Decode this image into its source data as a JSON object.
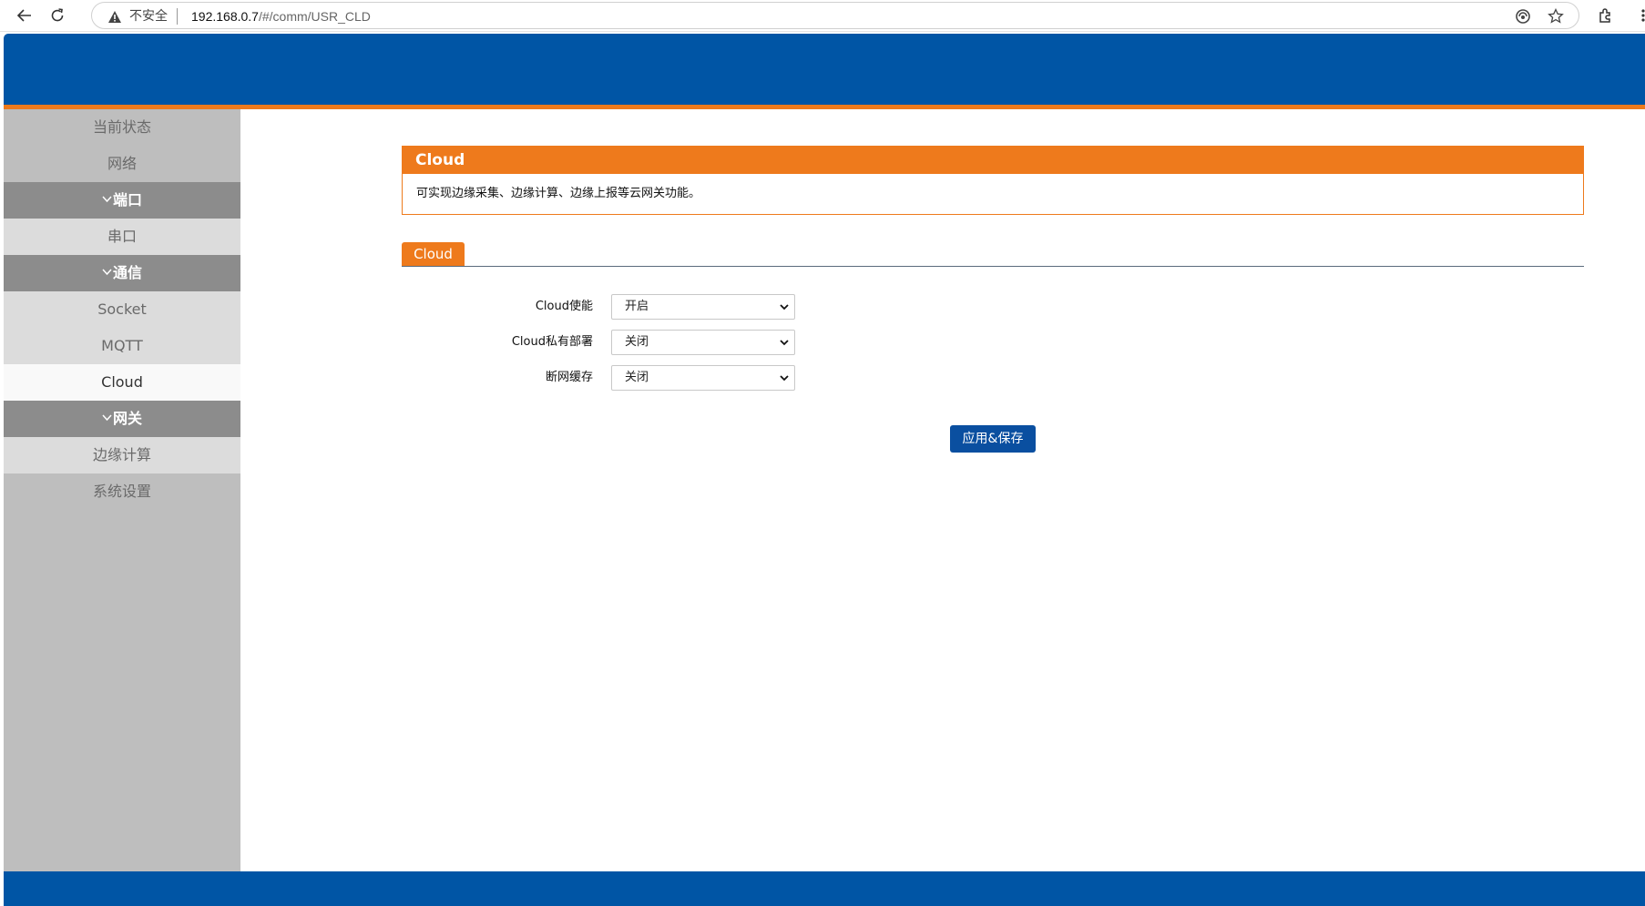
{
  "browser": {
    "insecure_label": "不安全",
    "url_host": "192.168.0.7",
    "url_path": "/#/comm/USR_CLD"
  },
  "sidebar": {
    "items": [
      {
        "label": "当前状态"
      },
      {
        "label": "网络"
      },
      {
        "label": "端口"
      },
      {
        "label": "串口"
      },
      {
        "label": "通信"
      },
      {
        "label": "Socket"
      },
      {
        "label": "MQTT"
      },
      {
        "label": "Cloud"
      },
      {
        "label": "网关"
      },
      {
        "label": "边缘计算"
      },
      {
        "label": "系统设置"
      }
    ]
  },
  "panel": {
    "title": "Cloud",
    "description": "可实现边缘采集、边缘计算、边缘上报等云网关功能。"
  },
  "tab": {
    "label": "Cloud"
  },
  "form": {
    "rows": [
      {
        "label": "Cloud使能",
        "value": "开启"
      },
      {
        "label": "Cloud私有部署",
        "value": "关闭"
      },
      {
        "label": "断网缓存",
        "value": "关闭"
      }
    ],
    "apply_label": "应用&保存"
  },
  "colors": {
    "brand_blue": "#0055a5",
    "accent_orange": "#ee7a1c",
    "button_blue": "#0a4fa0"
  }
}
